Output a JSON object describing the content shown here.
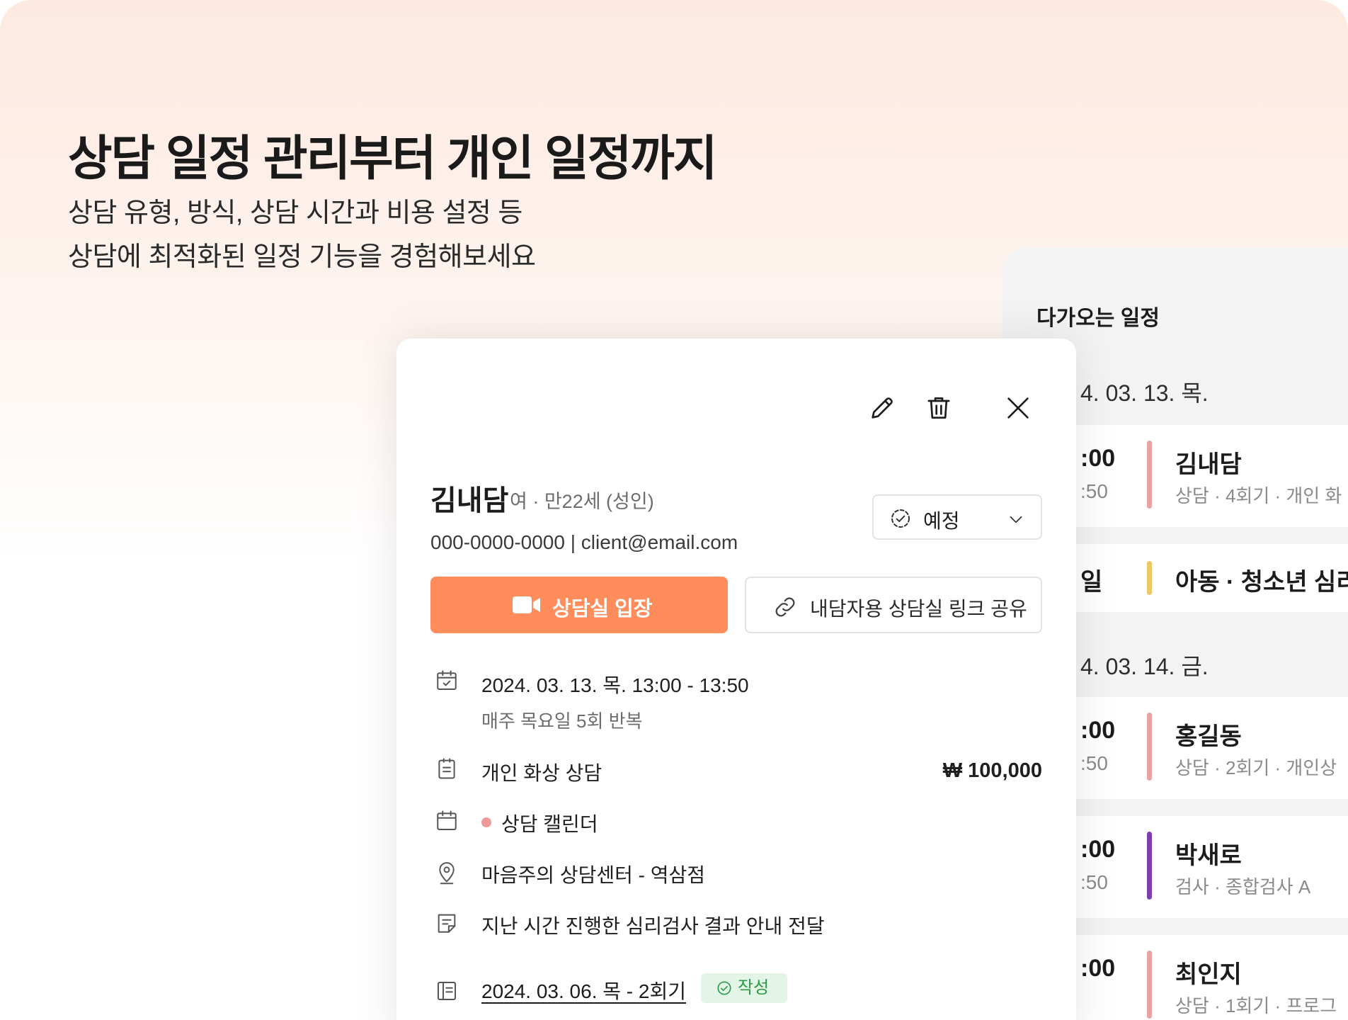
{
  "hero": {
    "title": "상담 일정 관리부터 개인 일정까지",
    "subtitle_line1": "상담 유형, 방식, 상담 시간과 비용 설정 등",
    "subtitle_line2": "상담에 최적화된 일정 기능을 경험해보세요"
  },
  "upcoming": {
    "title": "다가오는 일정",
    "days": [
      {
        "date": "4. 03. 13. 목.",
        "events": [
          {
            "time": ":00",
            "time_end": ":50",
            "color": "#e8a3a3",
            "name": "김내담",
            "detail": "상담 · 4회기 · 개인 화"
          },
          {
            "time": "일",
            "time_end": "",
            "color": "#ecc764",
            "name": "아동 · 청소년 심리",
            "detail": ""
          }
        ]
      },
      {
        "date": "4. 03. 14. 금.",
        "events": [
          {
            "time": ":00",
            "time_end": ":50",
            "color": "#e8a3a3",
            "name": "홍길동",
            "detail": "상담 · 2회기 · 개인상"
          },
          {
            "time": ":00",
            "time_end": ":50",
            "color": "#7b3fb0",
            "name": "박새로",
            "detail": "검사 · 종합검사 A"
          },
          {
            "time": ":00",
            "time_end": "",
            "color": "#e8a3a3",
            "name": "최인지",
            "detail": "상담 · 1회기 · 프로그"
          }
        ]
      }
    ]
  },
  "card": {
    "toolbar": {
      "edit_icon": "pencil-icon",
      "delete_icon": "trash-icon",
      "close_icon": "close-icon"
    },
    "client": {
      "name": "김내담",
      "meta": "여 · 만22세 (성인)",
      "contact": "000-0000-0000 | client@email.com"
    },
    "status": {
      "label": "예정",
      "icon": "dashed-check-circle-icon"
    },
    "enter_button": {
      "label": "상담실 입장",
      "icon": "video-camera-icon",
      "color": "#ff8d5c"
    },
    "share_button": {
      "label": "내담자용 상담실 링크 공유",
      "icon": "link-icon"
    },
    "details": {
      "datetime": "2024. 03. 13. 목. 13:00 - 13:50",
      "repeat": "매주 목요일 5회 반복",
      "type": "개인 화상 상담",
      "fee": "₩ 100,000",
      "calendar": "상담 캘린더",
      "calendar_color": "#ef9a9a",
      "location": "마음주의 상담센터 - 역삼점",
      "memo": "지난 시간 진행한 심리검사 결과 안내 전달",
      "previous_session": "2024. 03. 06. 목 - 2회기",
      "previous_badge": "작성"
    }
  }
}
